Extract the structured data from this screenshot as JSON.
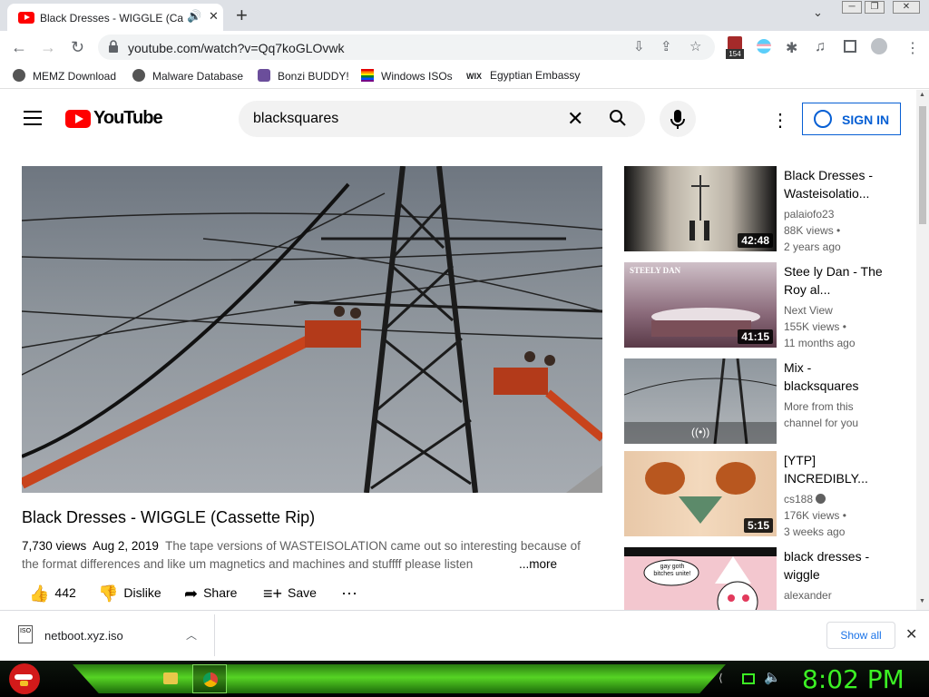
{
  "browser": {
    "tab_title": "Black Dresses - WIGGLE (Cassette Rip) - YouTube",
    "url": "youtube.com/watch?v=Qq7koGLOvwk",
    "extension_badge": "154"
  },
  "bookmarks": [
    {
      "label": "MEMZ Download"
    },
    {
      "label": "Malware Database"
    },
    {
      "label": "Bonzi BUDDY!"
    },
    {
      "label": "Windows ISOs"
    },
    {
      "label": "Egyptian Embassy"
    }
  ],
  "youtube": {
    "logo_text": "YouTube",
    "search_value": "blacksquares",
    "sign_in_label": "SIGN IN"
  },
  "video": {
    "title": "Black Dresses - WIGGLE (Cassette Rip)",
    "views": "7,730 views",
    "date": "Aug 2, 2019",
    "description": "The tape versions of WASTEISOLATION came out so interesting because of the format differences and like um magnetics and machines and stuffff please listen",
    "more_label": "...more",
    "actions": {
      "like_count": "442",
      "dislike_label": "Dislike",
      "share_label": "Share",
      "save_label": "Save"
    }
  },
  "recommendations": [
    {
      "title": "Black Dresses - Wasteisolatio...",
      "channel": "palaiofo23",
      "views": "88K views •",
      "age": "2 years ago",
      "duration": "42:48"
    },
    {
      "title": "Stee ly Dan - The Roy al...",
      "channel": "Next View",
      "views": "155K views •",
      "age": "11 months ago",
      "duration": "41:15",
      "thumb_text": "STEELY DAN"
    },
    {
      "title": "Mix - blacksquares",
      "channel": "More from this",
      "views": "channel for you",
      "age": "",
      "duration": ""
    },
    {
      "title": "[YTP] INCREDIBLY...",
      "channel": "cs188",
      "views": "176K views •",
      "age": "3 weeks ago",
      "duration": "5:15"
    },
    {
      "title": "black dresses - wiggle",
      "channel": "alexander",
      "views": "",
      "age": "",
      "duration": "",
      "thumb_text": "gay goth bitches unite!"
    }
  ],
  "download": {
    "icon_text": "ISO",
    "filename": "netboot.xyz.iso",
    "show_all_label": "Show all"
  },
  "taskbar": {
    "clock": "8:02 PM"
  },
  "colors": {
    "youtube_red": "#ff0000",
    "link_blue": "#065fd4",
    "taskbar_green": "#3cf024"
  }
}
